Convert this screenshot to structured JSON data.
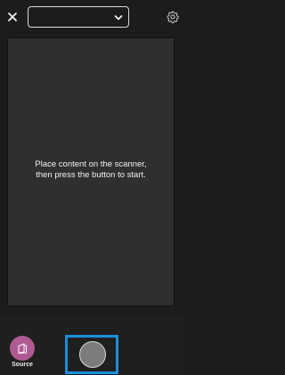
{
  "top_bar": {
    "close_icon": "close-icon",
    "source_dropdown": {
      "value": "",
      "icon": "chevron-down-icon"
    },
    "settings_icon": "gear-icon"
  },
  "preview": {
    "message": "Place content on the scanner, then press the button to start."
  },
  "bottom_bar": {
    "source_button": {
      "label": "Source",
      "icon": "source-icon",
      "color": "#b05a93"
    },
    "capture_button": {
      "icon": "shutter-icon",
      "highlight_color": "#1b8ed8"
    }
  }
}
